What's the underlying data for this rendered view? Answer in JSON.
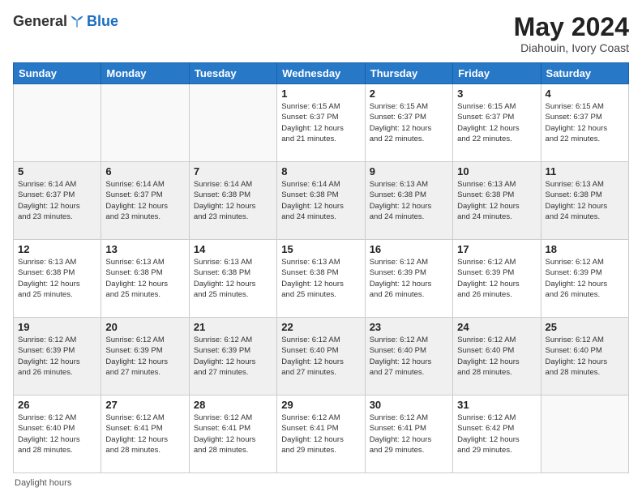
{
  "header": {
    "logo_general": "General",
    "logo_blue": "Blue",
    "month_title": "May 2024",
    "subtitle": "Diahouin, Ivory Coast"
  },
  "days_of_week": [
    "Sunday",
    "Monday",
    "Tuesday",
    "Wednesday",
    "Thursday",
    "Friday",
    "Saturday"
  ],
  "footer": {
    "daylight_label": "Daylight hours"
  },
  "weeks": [
    [
      {
        "day": "",
        "info": ""
      },
      {
        "day": "",
        "info": ""
      },
      {
        "day": "",
        "info": ""
      },
      {
        "day": "1",
        "info": "Sunrise: 6:15 AM\nSunset: 6:37 PM\nDaylight: 12 hours\nand 21 minutes."
      },
      {
        "day": "2",
        "info": "Sunrise: 6:15 AM\nSunset: 6:37 PM\nDaylight: 12 hours\nand 22 minutes."
      },
      {
        "day": "3",
        "info": "Sunrise: 6:15 AM\nSunset: 6:37 PM\nDaylight: 12 hours\nand 22 minutes."
      },
      {
        "day": "4",
        "info": "Sunrise: 6:15 AM\nSunset: 6:37 PM\nDaylight: 12 hours\nand 22 minutes."
      }
    ],
    [
      {
        "day": "5",
        "info": "Sunrise: 6:14 AM\nSunset: 6:37 PM\nDaylight: 12 hours\nand 23 minutes."
      },
      {
        "day": "6",
        "info": "Sunrise: 6:14 AM\nSunset: 6:37 PM\nDaylight: 12 hours\nand 23 minutes."
      },
      {
        "day": "7",
        "info": "Sunrise: 6:14 AM\nSunset: 6:38 PM\nDaylight: 12 hours\nand 23 minutes."
      },
      {
        "day": "8",
        "info": "Sunrise: 6:14 AM\nSunset: 6:38 PM\nDaylight: 12 hours\nand 24 minutes."
      },
      {
        "day": "9",
        "info": "Sunrise: 6:13 AM\nSunset: 6:38 PM\nDaylight: 12 hours\nand 24 minutes."
      },
      {
        "day": "10",
        "info": "Sunrise: 6:13 AM\nSunset: 6:38 PM\nDaylight: 12 hours\nand 24 minutes."
      },
      {
        "day": "11",
        "info": "Sunrise: 6:13 AM\nSunset: 6:38 PM\nDaylight: 12 hours\nand 24 minutes."
      }
    ],
    [
      {
        "day": "12",
        "info": "Sunrise: 6:13 AM\nSunset: 6:38 PM\nDaylight: 12 hours\nand 25 minutes."
      },
      {
        "day": "13",
        "info": "Sunrise: 6:13 AM\nSunset: 6:38 PM\nDaylight: 12 hours\nand 25 minutes."
      },
      {
        "day": "14",
        "info": "Sunrise: 6:13 AM\nSunset: 6:38 PM\nDaylight: 12 hours\nand 25 minutes."
      },
      {
        "day": "15",
        "info": "Sunrise: 6:13 AM\nSunset: 6:38 PM\nDaylight: 12 hours\nand 25 minutes."
      },
      {
        "day": "16",
        "info": "Sunrise: 6:12 AM\nSunset: 6:39 PM\nDaylight: 12 hours\nand 26 minutes."
      },
      {
        "day": "17",
        "info": "Sunrise: 6:12 AM\nSunset: 6:39 PM\nDaylight: 12 hours\nand 26 minutes."
      },
      {
        "day": "18",
        "info": "Sunrise: 6:12 AM\nSunset: 6:39 PM\nDaylight: 12 hours\nand 26 minutes."
      }
    ],
    [
      {
        "day": "19",
        "info": "Sunrise: 6:12 AM\nSunset: 6:39 PM\nDaylight: 12 hours\nand 26 minutes."
      },
      {
        "day": "20",
        "info": "Sunrise: 6:12 AM\nSunset: 6:39 PM\nDaylight: 12 hours\nand 27 minutes."
      },
      {
        "day": "21",
        "info": "Sunrise: 6:12 AM\nSunset: 6:39 PM\nDaylight: 12 hours\nand 27 minutes."
      },
      {
        "day": "22",
        "info": "Sunrise: 6:12 AM\nSunset: 6:40 PM\nDaylight: 12 hours\nand 27 minutes."
      },
      {
        "day": "23",
        "info": "Sunrise: 6:12 AM\nSunset: 6:40 PM\nDaylight: 12 hours\nand 27 minutes."
      },
      {
        "day": "24",
        "info": "Sunrise: 6:12 AM\nSunset: 6:40 PM\nDaylight: 12 hours\nand 28 minutes."
      },
      {
        "day": "25",
        "info": "Sunrise: 6:12 AM\nSunset: 6:40 PM\nDaylight: 12 hours\nand 28 minutes."
      }
    ],
    [
      {
        "day": "26",
        "info": "Sunrise: 6:12 AM\nSunset: 6:40 PM\nDaylight: 12 hours\nand 28 minutes."
      },
      {
        "day": "27",
        "info": "Sunrise: 6:12 AM\nSunset: 6:41 PM\nDaylight: 12 hours\nand 28 minutes."
      },
      {
        "day": "28",
        "info": "Sunrise: 6:12 AM\nSunset: 6:41 PM\nDaylight: 12 hours\nand 28 minutes."
      },
      {
        "day": "29",
        "info": "Sunrise: 6:12 AM\nSunset: 6:41 PM\nDaylight: 12 hours\nand 29 minutes."
      },
      {
        "day": "30",
        "info": "Sunrise: 6:12 AM\nSunset: 6:41 PM\nDaylight: 12 hours\nand 29 minutes."
      },
      {
        "day": "31",
        "info": "Sunrise: 6:12 AM\nSunset: 6:42 PM\nDaylight: 12 hours\nand 29 minutes."
      },
      {
        "day": "",
        "info": ""
      }
    ]
  ]
}
